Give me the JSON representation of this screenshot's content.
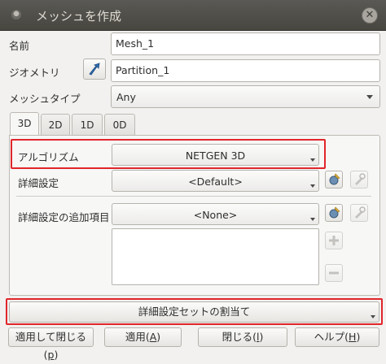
{
  "window": {
    "title": "メッシュを作成",
    "close_glyph": "✕"
  },
  "form": {
    "name_label": "名前",
    "name_value": "Mesh_1",
    "geometry_label": "ジオメトリ",
    "geometry_value": "Partition_1",
    "mesh_type_label": "メッシュタイプ",
    "mesh_type_value": "Any"
  },
  "tabs": [
    {
      "label": "3D",
      "active": true
    },
    {
      "label": "2D",
      "active": false
    },
    {
      "label": "1D",
      "active": false
    },
    {
      "label": "0D",
      "active": false
    }
  ],
  "panel": {
    "algorithm_label": "アルゴリズム",
    "algorithm_value": "NETGEN 3D",
    "hypothesis_label": "詳細設定",
    "hypothesis_value": "<Default>",
    "add_hypothesis_label": "詳細設定の追加項目",
    "add_hypothesis_value": "<None>"
  },
  "assign_button": "詳細設定セットの割当て",
  "footer": {
    "apply_close": {
      "text": "適用して閉じる(",
      "key": "p",
      "end": ")"
    },
    "apply": {
      "text": "適用(",
      "key": "A",
      "end": ")"
    },
    "close": {
      "text": "閉じる(",
      "key": "l",
      "end": ")"
    },
    "help": {
      "text": "ヘルプ(",
      "key": "H",
      "end": ")"
    }
  },
  "icons": [
    "window-menu-icon",
    "close-icon",
    "select-arrow-icon",
    "edit-hypothesis-icon",
    "hypothesis-tool-icon",
    "add-icon",
    "remove-icon"
  ],
  "colors": {
    "highlight": "#e0262b",
    "titlebar": "#4f4e49"
  }
}
